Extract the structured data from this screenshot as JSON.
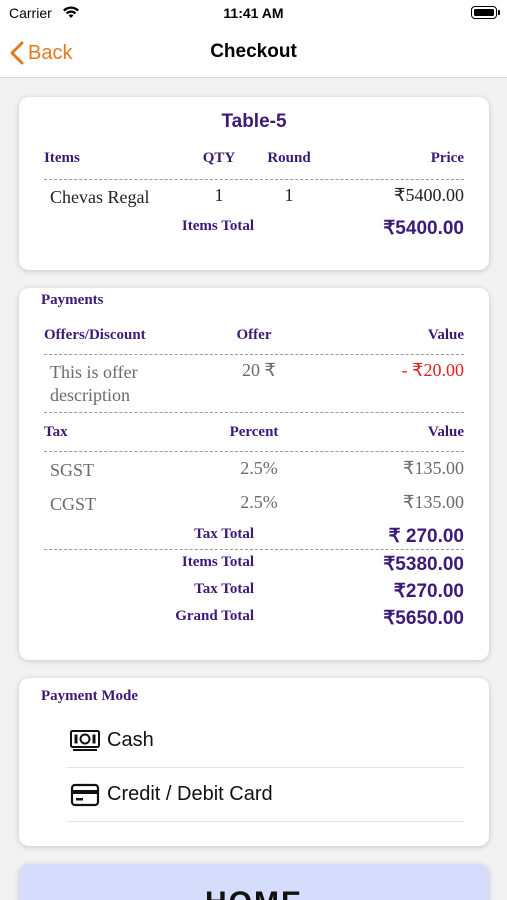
{
  "status_bar": {
    "carrier": "Carrier",
    "time": "11:41 AM"
  },
  "nav": {
    "back_label": "Back",
    "title": "Checkout"
  },
  "order": {
    "table_name": "Table-5",
    "headers": {
      "items": "Items",
      "qty": "QTY",
      "round": "Round",
      "price": "Price"
    },
    "items": [
      {
        "name": "Chevas Regal",
        "qty": "1",
        "round": "1",
        "price": "₹5400.00"
      }
    ],
    "items_total_label": "Items Total",
    "items_total_value": "₹5400.00"
  },
  "payments": {
    "title": "Payments",
    "offer_headers": {
      "offers": "Offers/Discount",
      "offer": "Offer",
      "value": "Value"
    },
    "offers": [
      {
        "description_line1": "This is offer",
        "description_line2": "description",
        "offer": "20 ₹",
        "value": "-  ₹20.00"
      }
    ],
    "tax_headers": {
      "tax": "Tax",
      "percent": "Percent",
      "value": "Value"
    },
    "taxes": [
      {
        "name": "SGST",
        "percent": "2.5%",
        "value": "₹135.00"
      },
      {
        "name": "CGST",
        "percent": "2.5%",
        "value": "₹135.00"
      }
    ],
    "tax_total_label": "Tax Total",
    "tax_total_value": "₹ 270.00",
    "summary": [
      {
        "label": "Items Total",
        "value": "₹5380.00"
      },
      {
        "label": "Tax Total",
        "value": "₹270.00"
      },
      {
        "label": "Grand Total",
        "value": "₹5650.00"
      }
    ]
  },
  "payment_mode": {
    "title": "Payment Mode",
    "options": [
      {
        "label": "Cash",
        "icon": "cash-icon"
      },
      {
        "label": "Credit / Debit Card",
        "icon": "credit-card-icon"
      }
    ]
  },
  "home_button": {
    "label": "HOME"
  },
  "colors": {
    "accent": "#3c1a78",
    "back": "#e07a1f",
    "discount": "#e02020",
    "home_bg": "#d6dcfb"
  }
}
